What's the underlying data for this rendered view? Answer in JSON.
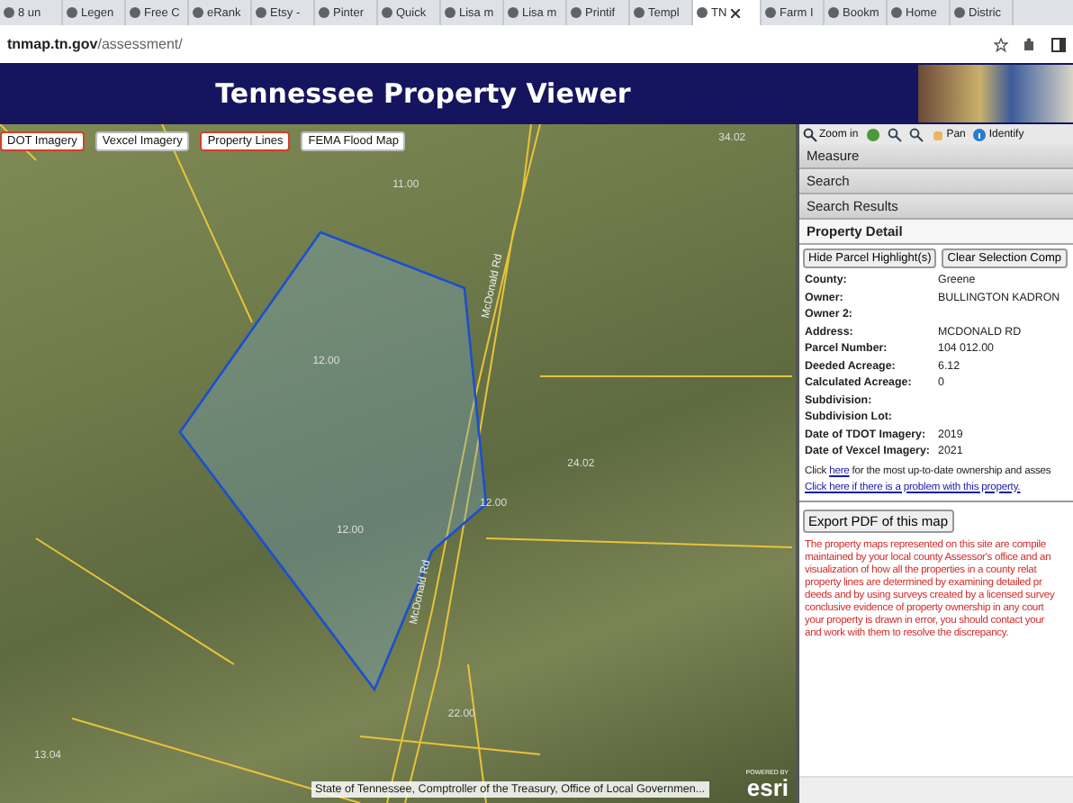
{
  "browser": {
    "tabs": [
      {
        "label": "8 un",
        "selected": false
      },
      {
        "label": "Legen",
        "selected": false
      },
      {
        "label": "Free C",
        "selected": false
      },
      {
        "label": "eRank",
        "selected": false
      },
      {
        "label": "Etsy -",
        "selected": false
      },
      {
        "label": "Pinter",
        "selected": false
      },
      {
        "label": "Quick",
        "selected": false
      },
      {
        "label": "Lisa m",
        "selected": false
      },
      {
        "label": "Lisa m",
        "selected": false
      },
      {
        "label": "Printif",
        "selected": false
      },
      {
        "label": "Templ",
        "selected": false
      },
      {
        "label": "TN",
        "selected": true
      },
      {
        "label": "Farm I",
        "selected": false
      },
      {
        "label": "Bookm",
        "selected": false
      },
      {
        "label": "Home",
        "selected": false
      },
      {
        "label": "Distric",
        "selected": false
      }
    ],
    "url_host": "tnmap.tn.gov",
    "url_path": "/assessment/"
  },
  "header": {
    "title": "Tennessee Property Viewer"
  },
  "map": {
    "layers": [
      {
        "label": "DOT Imagery",
        "selected": true
      },
      {
        "label": "Vexcel Imagery",
        "selected": false
      },
      {
        "label": "Property Lines",
        "selected": true
      },
      {
        "label": "FEMA Flood Map",
        "selected": false
      }
    ],
    "labels": [
      "11.00",
      "34.02",
      "12.00",
      "12.00",
      "12.00",
      "24.02",
      "22.00",
      "13.04"
    ],
    "roads": [
      "McDonald Rd",
      "McDonald Rd"
    ],
    "attribution": "State of Tennessee, Comptroller of the Treasury, Office of Local Governmen...",
    "powered_by": "POWERED BY",
    "logo": "esri"
  },
  "panel": {
    "tools": [
      "Zoom in",
      "Pan",
      "Identify"
    ],
    "sections": [
      {
        "label": "Measure",
        "expanded": false
      },
      {
        "label": "Search",
        "expanded": false
      },
      {
        "label": "Search Results",
        "expanded": false
      },
      {
        "label": "Property Detail",
        "expanded": true
      }
    ],
    "buttons": [
      "Hide Parcel Highlight(s)",
      "Clear Selection Comp"
    ],
    "details": [
      {
        "label": "County:",
        "value": "Greene"
      },
      {
        "label": "Owner:",
        "value": "BULLINGTON KADRON"
      },
      {
        "label": "Owner 2:"
      },
      {
        "label": "Address:",
        "value": "MCDONALD RD"
      },
      {
        "label": "Parcel Number:",
        "value": "104 012.00"
      },
      {
        "label": "Deeded Acreage:",
        "value": "6.12"
      },
      {
        "label": "Calculated Acreage:",
        "value": "0"
      },
      {
        "label": "Subdivision:"
      },
      {
        "label": "Subdivision Lot:"
      },
      {
        "label": "Date of TDOT Imagery:",
        "value": "2019"
      },
      {
        "label": "Date of Vexcel Imagery:",
        "value": "2021"
      }
    ],
    "click_before": "Click",
    "click_link": "here",
    "click_after": "for the most up-to-date ownership and asses",
    "problem_link": "Click here if there is a problem with this property.",
    "export_button": "Export PDF of this map",
    "disclaimer": [
      "The property maps represented on this site are compile",
      "maintained by your local county Assessor's office and an",
      "visualization of how all the properties in a county relat",
      "property lines are determined by examining detailed pr",
      "deeds and by using surveys created by a licensed survey",
      "conclusive evidence of property ownership in any court",
      "your property is drawn in error, you should contact your",
      "and work with them to resolve the discrepancy."
    ]
  }
}
